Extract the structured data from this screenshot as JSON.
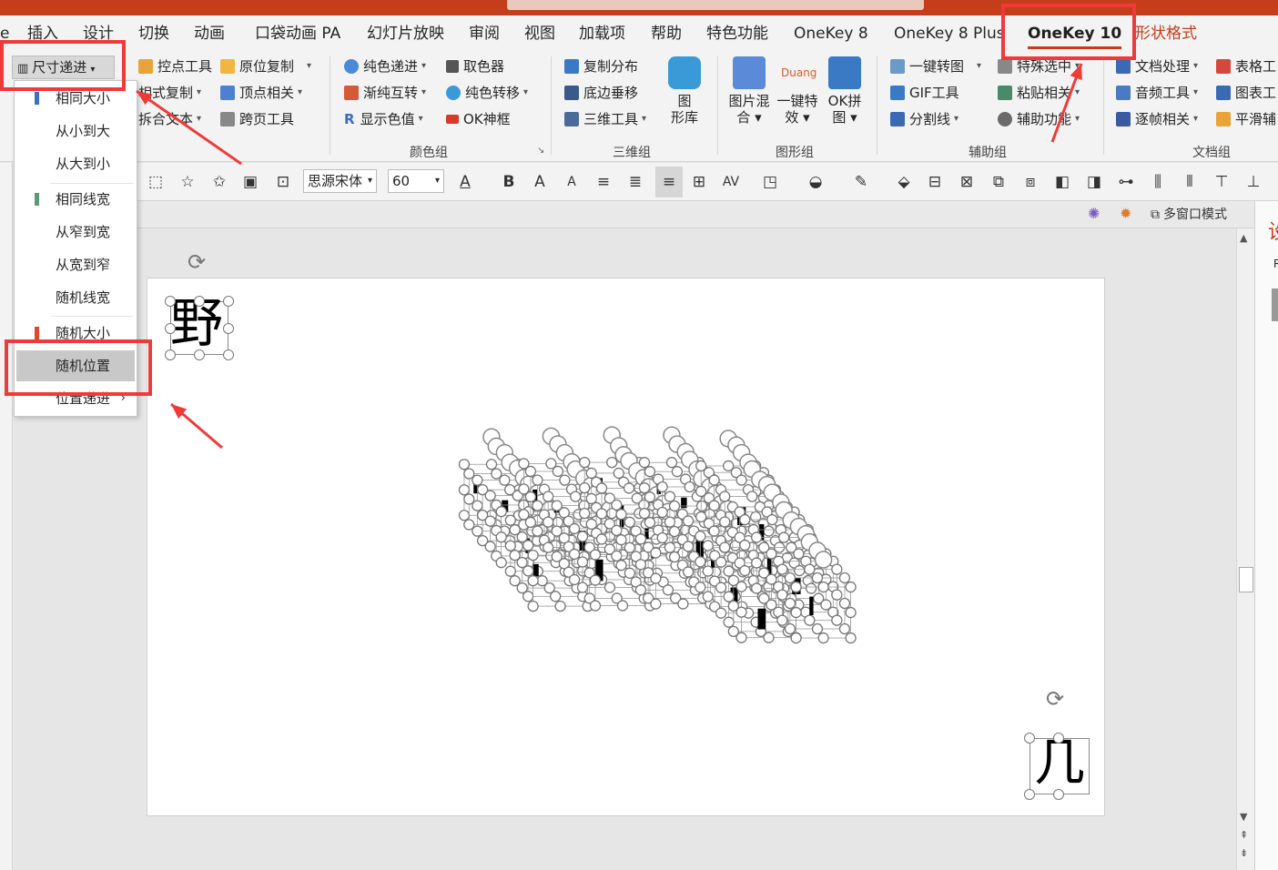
{
  "tabs": [
    {
      "id": "tab-e",
      "label": "e"
    },
    {
      "id": "tab-insert",
      "label": "插入"
    },
    {
      "id": "tab-design",
      "label": "设计"
    },
    {
      "id": "tab-transitions",
      "label": "切换"
    },
    {
      "id": "tab-animations",
      "label": "动画"
    },
    {
      "id": "tab-pocket-animation",
      "label": "口袋动画 PA"
    },
    {
      "id": "tab-slideshow",
      "label": "幻灯片放映"
    },
    {
      "id": "tab-review",
      "label": "审阅"
    },
    {
      "id": "tab-view",
      "label": "视图"
    },
    {
      "id": "tab-addins",
      "label": "加载项"
    },
    {
      "id": "tab-help",
      "label": "帮助"
    },
    {
      "id": "tab-special",
      "label": "特色功能"
    },
    {
      "id": "tab-onekey8",
      "label": "OneKey 8"
    },
    {
      "id": "tab-onekey8plus",
      "label": "OneKey 8 Plus"
    },
    {
      "id": "tab-onekey10",
      "label": "OneKey 10"
    },
    {
      "id": "tab-shape-format",
      "label": "形状格式"
    }
  ],
  "ribbon": {
    "size_progress_button": "尺寸递进",
    "col1": [
      "控点工具",
      "相式复制",
      "拆合文本"
    ],
    "col2": [
      "原位复制",
      "顶点相关",
      "跨页工具"
    ],
    "color_group": {
      "label": "颜色组",
      "items": [
        "纯色递进",
        "取色器",
        "渐纯互转",
        "纯色转移",
        "显示色值",
        "OK神框"
      ]
    },
    "threed_group": {
      "label": "三维组",
      "items": [
        "复制分布",
        "底边垂移",
        "三维工具"
      ],
      "big": [
        "图",
        "形库"
      ]
    },
    "shape_group": {
      "label": "图形组",
      "duang": "Duang",
      "big": [
        {
          "line1": "图片混",
          "line2": "合"
        },
        {
          "line1": "一键特",
          "line2": "效"
        },
        {
          "line1": "OK拼",
          "line2": "图"
        }
      ]
    },
    "aux_group": {
      "label": "辅助组",
      "items": [
        "一键转图",
        "特殊选中",
        "GIF工具",
        "粘贴相关",
        "分割线",
        "辅助功能"
      ]
    },
    "doc_group": {
      "label": "文档组",
      "items": [
        "文档处理",
        "表格工",
        "音频工具",
        "图表工",
        "逐帧相关",
        "平滑辅"
      ]
    }
  },
  "format_bar": {
    "font_name": "思源宋体",
    "font_size": "60",
    "bold": "B",
    "grow": "A",
    "shrink": "A",
    "spacing": "AV"
  },
  "sub_bar": {
    "multi_window": "多窗口模式"
  },
  "right_pane": {
    "title": "设",
    "char": "R"
  },
  "dropdown_menu": {
    "items": [
      {
        "label": "相同大小",
        "bar_color": "#3a6fc4"
      },
      {
        "label": "从小到大",
        "bar_color": ""
      },
      {
        "label": "从大到小",
        "bar_color": ""
      },
      {
        "label": "相同线宽",
        "bar_color": "#5a9a7a"
      },
      {
        "label": "从窄到宽",
        "bar_color": ""
      },
      {
        "label": "从宽到窄",
        "bar_color": ""
      },
      {
        "label": "随机线宽",
        "bar_color": ""
      },
      {
        "label": "随机大小",
        "bar_color": "#e04a2a"
      },
      {
        "label": "随机位置",
        "bar_color": ""
      },
      {
        "label": "位置递进",
        "bar_color": ""
      }
    ],
    "selected": "随机位置"
  },
  "slide": {
    "top_left_char": "野",
    "bottom_right_char": "几"
  },
  "accent_color": "#c43e1c",
  "annotation_color": "#f03a3a"
}
